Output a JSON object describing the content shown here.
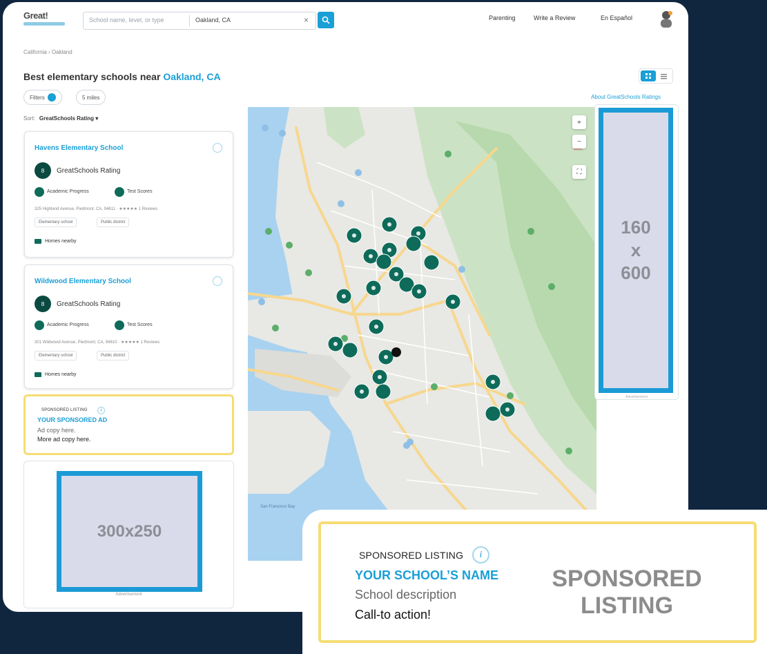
{
  "header": {
    "logo_text": "Great!",
    "search_placeholder": "School name, level, or type",
    "location_value": "Oakland, CA",
    "clear_glyph": "×",
    "nav": [
      "Parenting",
      "Write a Review",
      "En Español"
    ]
  },
  "breadcrumb": "California › Oakland",
  "title": {
    "prefix": "Best elementary schools near ",
    "place": "Oakland, CA"
  },
  "filters": {
    "filters_label": "Filters",
    "distance_label": "5 miles",
    "about_link": "About GreatSchools Ratings"
  },
  "sort": {
    "label": "Sort:",
    "value": "GreatSchools Rating ▾"
  },
  "cards": [
    {
      "name": "Havens Elementary School",
      "rating_label": "GreatSchools Rating",
      "sub1": "Academic Progress",
      "sub2": "Test Scores",
      "address": "325 Highland Avenue, Piedmont, CA, 94611 · ★★★★★ 1 Reviews",
      "tags": [
        "Elementary school",
        "Public district"
      ],
      "homes": "Homes nearby"
    },
    {
      "name": "Wildwood Elementary School",
      "rating_label": "GreatSchools Rating",
      "sub1": "Academic Progress",
      "sub2": "Test Scores",
      "address": "301 Wildwood Avenue, Piedmont, CA, 94610 · ★★★★★ 1 Reviews",
      "tags": [
        "Elementary school",
        "Public district"
      ],
      "homes": "Homes nearby"
    }
  ],
  "sponsored_small": {
    "label": "SPONSORED LISTING",
    "info": "i",
    "title": "YOUR SPONSORED AD",
    "line1": "Ad copy here.",
    "line2": "More ad copy here."
  },
  "ad300": {
    "text": "300x250",
    "note": "Advertisement"
  },
  "skyscraper": {
    "line1": "160",
    "line2": "x",
    "line3": "600",
    "note": "Advertisement"
  },
  "map": {
    "controls": [
      "⌖",
      "−",
      "⛶"
    ],
    "water_label": "San Francisco Bay"
  },
  "sponsored_big": {
    "label": "SPONSORED LISTING",
    "info": "i",
    "title": "YOUR SCHOOL’S NAME",
    "line1": "School description",
    "line2": "Call-to action!",
    "big_line1": "SPONSORED",
    "big_line2": "LISTING"
  },
  "colors": {
    "accent": "#1a9fd6",
    "sponsor_border": "#f6dc73",
    "marker": "#0e6b5a",
    "background": "#10263f"
  }
}
